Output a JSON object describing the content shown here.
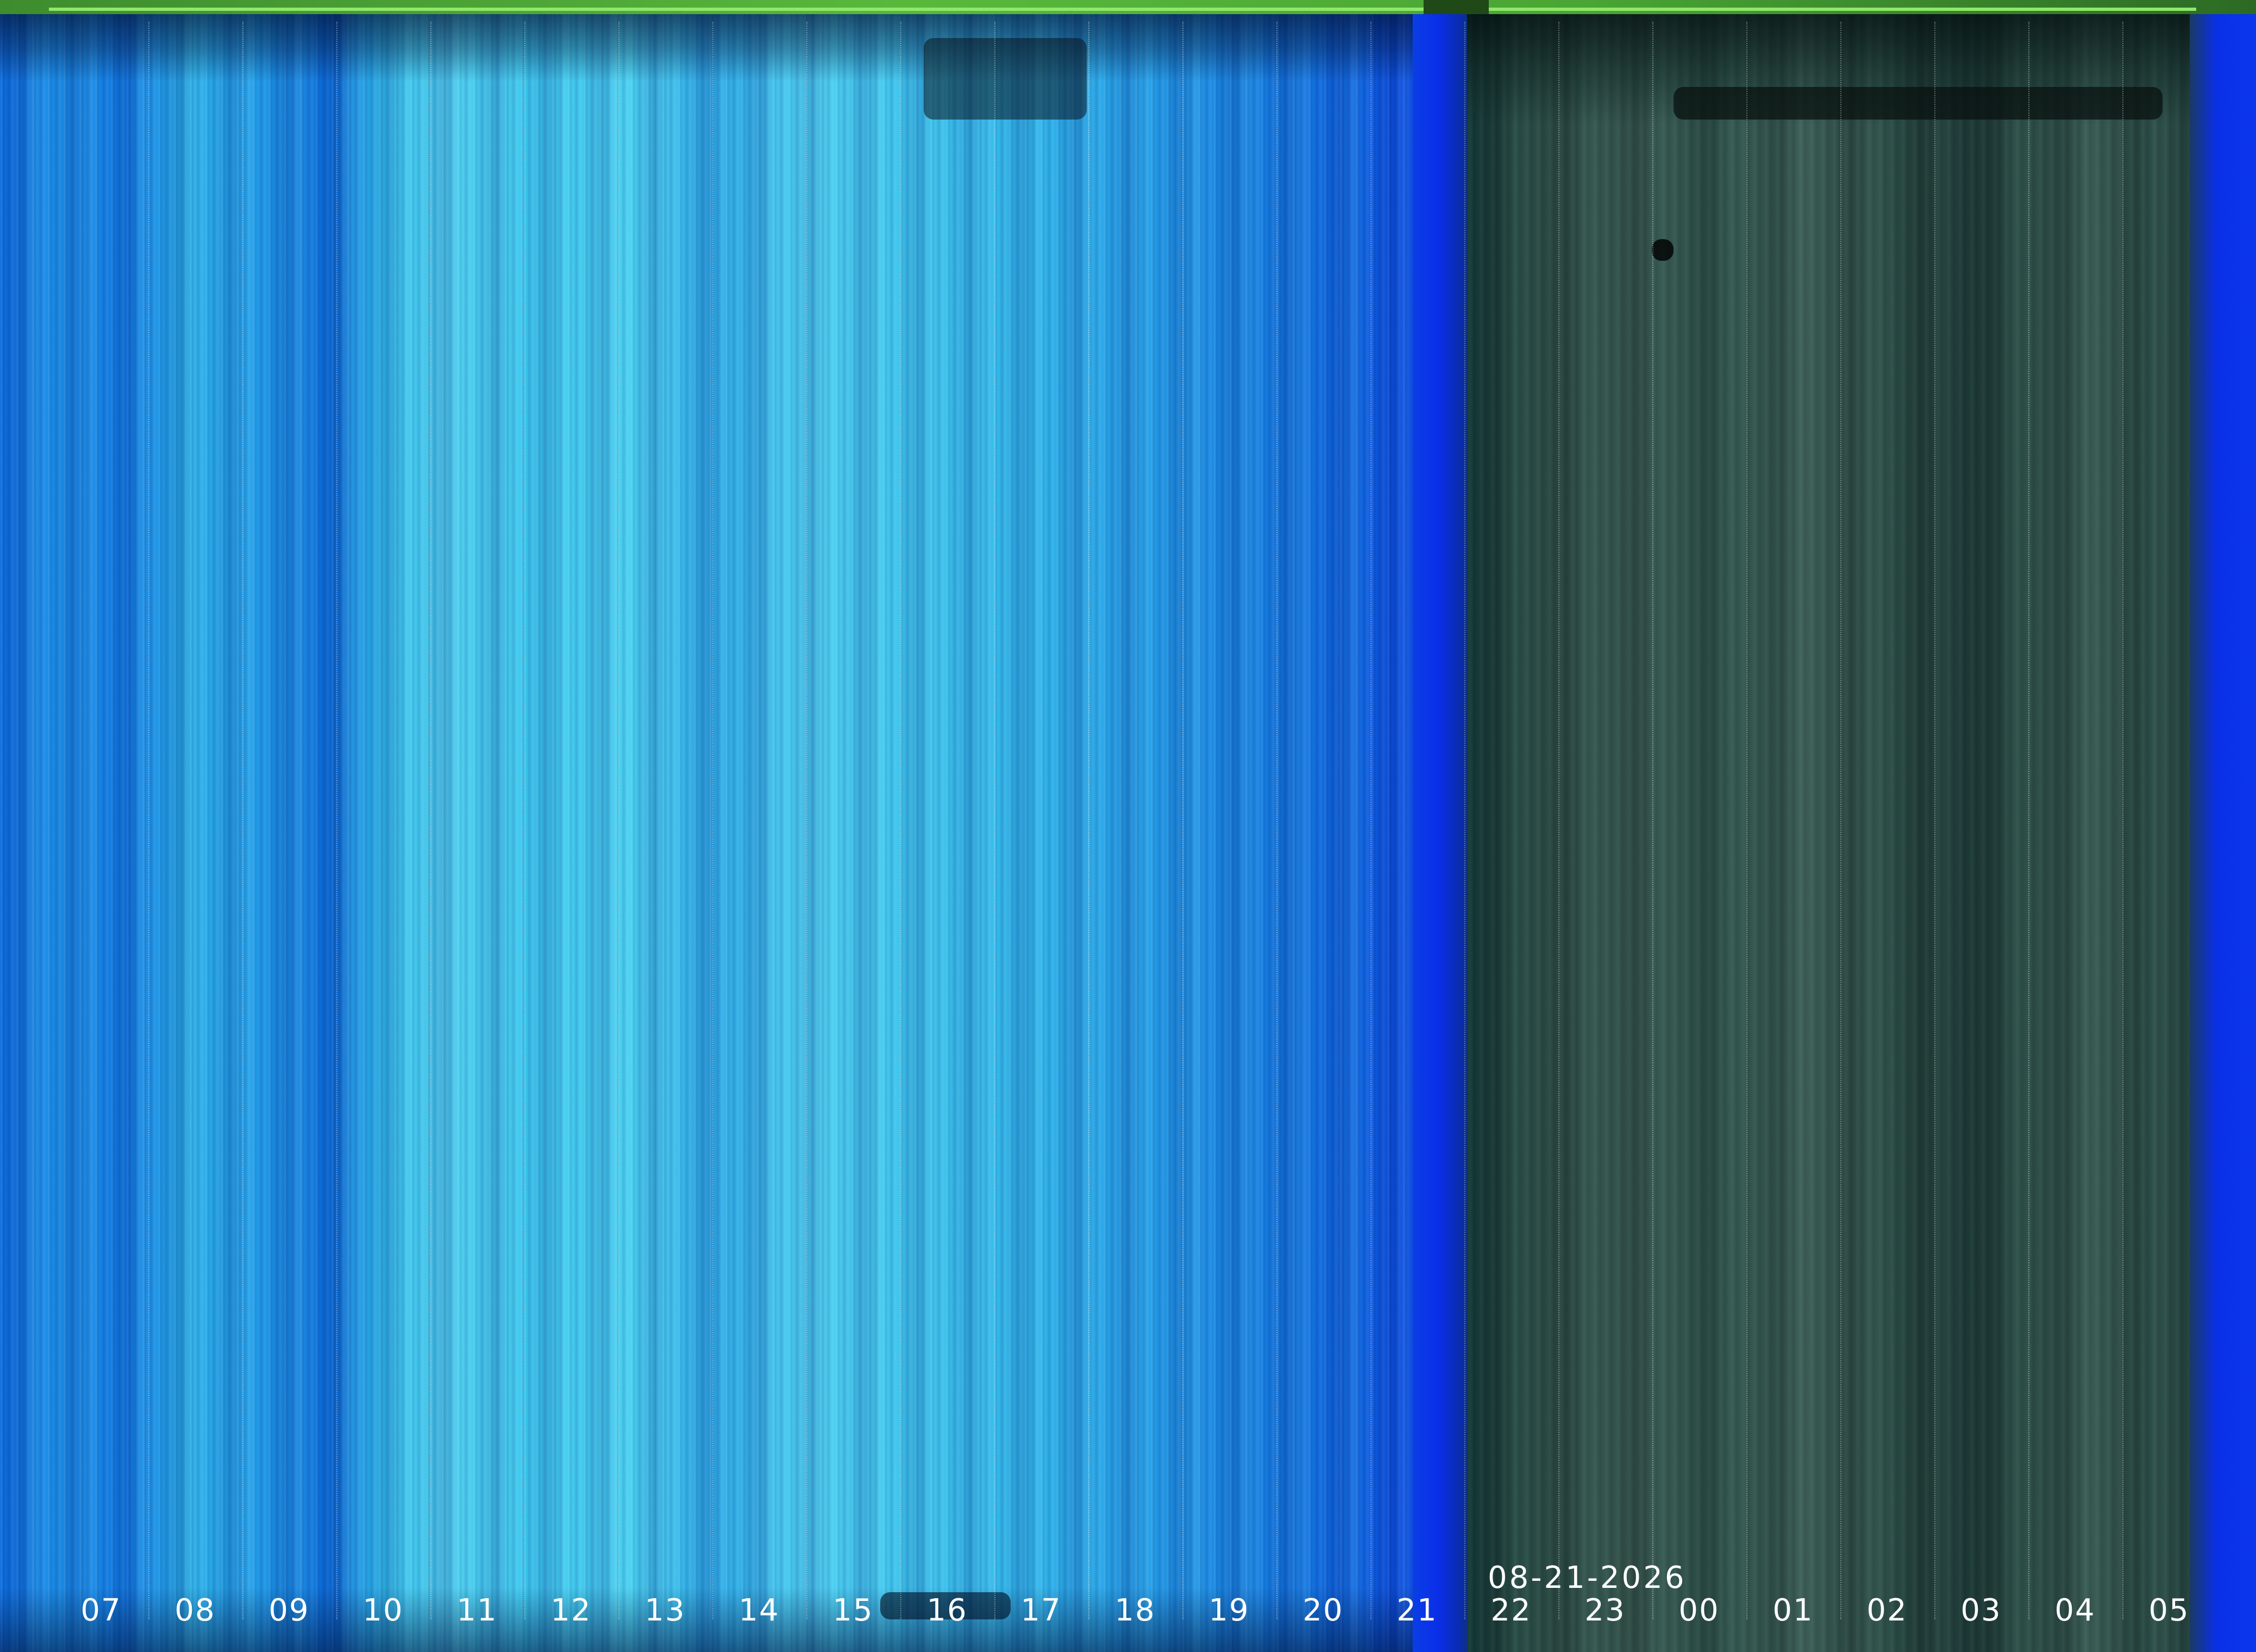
{
  "image": {
    "kind": "keogram",
    "date": "08-21-2026",
    "hour_labels": [
      "07",
      "08",
      "09",
      "10",
      "11",
      "12",
      "13",
      "14",
      "15",
      "16",
      "17",
      "18",
      "19",
      "20",
      "21",
      "22",
      "23",
      "00",
      "01",
      "02",
      "03",
      "04",
      "05"
    ],
    "colors": {
      "day_sky": "#2cb2ea",
      "twilight_blue": "#0a30e6",
      "night_sky": "#2f534c",
      "top_strip": "#58b83c",
      "label_text": "#ffffff"
    }
  }
}
